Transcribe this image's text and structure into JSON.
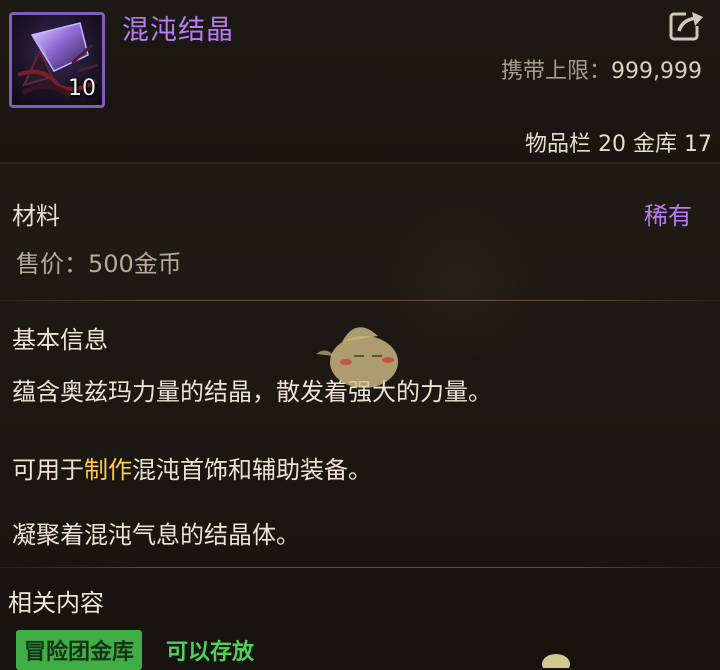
{
  "item": {
    "name": "混沌结晶",
    "count": "10",
    "carry_limit_label": "携带上限：",
    "carry_limit_value": "999,999",
    "storage_text": "物品栏 20 金库 17",
    "category": "材料",
    "rarity": "稀有",
    "price": "售价：500金币"
  },
  "basic_info": {
    "title": "基本信息",
    "line1": "蕴含奥兹玛力量的结晶，散发着强大的力量。",
    "line2_prefix": "可用于",
    "line2_highlight": "制作",
    "line2_suffix": "混沌首饰和辅助装备。",
    "line3": "凝聚着混沌气息的结晶体。"
  },
  "related": {
    "title": "相关内容",
    "tag": "冒险团金库",
    "tag_note": "可以存放"
  },
  "colors": {
    "item_name": "#b77cf0",
    "rarity": "#b77cf0",
    "highlight": "#ffcc44",
    "tag_bg": "#3fae45",
    "tag_note": "#4fd15a"
  },
  "icons": {
    "item": "chaos-crystal-icon",
    "share": "share-icon",
    "watermark": "mascot-watermark"
  }
}
